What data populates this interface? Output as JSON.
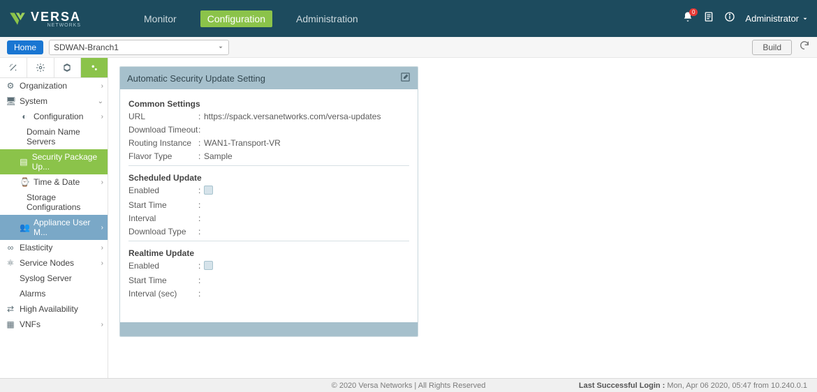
{
  "brand": {
    "name": "VERSA",
    "sub": "NETWORKS"
  },
  "topnav": {
    "monitor": "Monitor",
    "configuration": "Configuration",
    "administration": "Administration"
  },
  "header": {
    "notifications": "0",
    "admin": "Administrator"
  },
  "subbar": {
    "home": "Home",
    "branch": "SDWAN-Branch1",
    "build": "Build"
  },
  "sidebar": {
    "organization": "Organization",
    "system": "System",
    "configuration": "Configuration",
    "dns": "Domain Name Servers",
    "secpkg": "Security Package Up...",
    "timedate": "Time & Date",
    "storage": "Storage Configurations",
    "appuser": "Appliance User M...",
    "elasticity": "Elasticity",
    "servicenodes": "Service Nodes",
    "syslog": "Syslog Server",
    "alarms": "Alarms",
    "ha": "High Availability",
    "vnfs": "VNFs"
  },
  "panel": {
    "title": "Automatic Security Update Setting",
    "common": {
      "heading": "Common Settings",
      "url_label": "URL",
      "url_value": "https://spack.versanetworks.com/versa-updates",
      "download_timeout_label": "Download Timeout",
      "download_timeout_value": "",
      "routing_label": "Routing Instance",
      "routing_value": "WAN1-Transport-VR",
      "flavor_label": "Flavor Type",
      "flavor_value": "Sample"
    },
    "scheduled": {
      "heading": "Scheduled Update",
      "enabled_label": "Enabled",
      "start_label": "Start Time",
      "start_value": "",
      "interval_label": "Interval",
      "interval_value": "",
      "download_type_label": "Download Type",
      "download_type_value": ""
    },
    "realtime": {
      "heading": "Realtime Update",
      "enabled_label": "Enabled",
      "start_label": "Start Time",
      "start_value": "",
      "interval_label": "Interval (sec)",
      "interval_value": ""
    }
  },
  "footer": {
    "copyright": "© 2020 Versa Networks | All Rights Reserved",
    "login_label": "Last Successful Login :",
    "login_value": "Mon, Apr 06 2020, 05:47 from 10.240.0.1"
  }
}
